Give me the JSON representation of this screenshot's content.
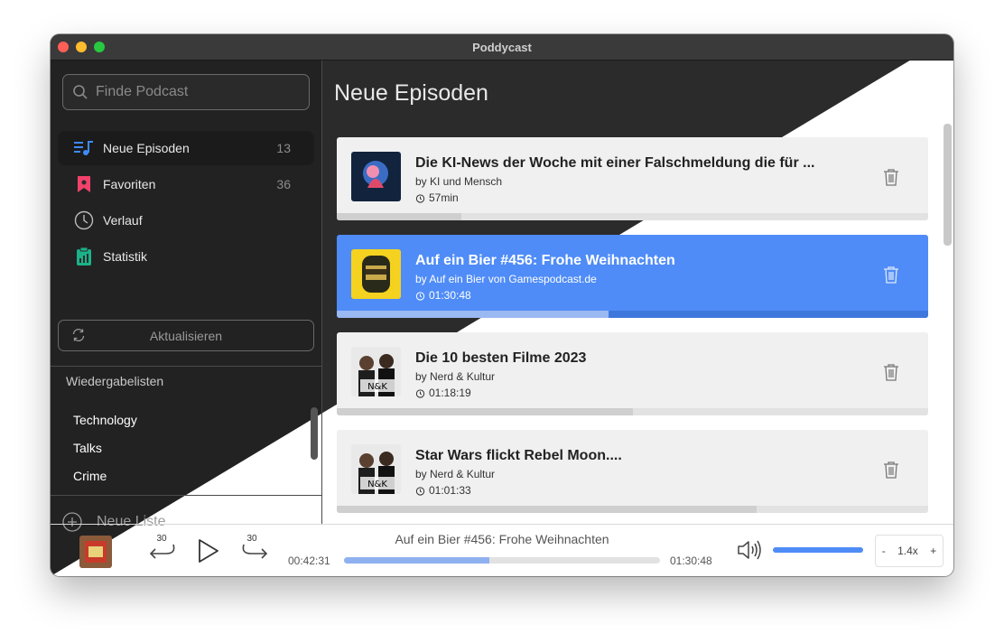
{
  "window": {
    "title": "Poddycast"
  },
  "search": {
    "placeholder": "Finde Podcast"
  },
  "nav": [
    {
      "label": "Neue Episoden",
      "count": "13",
      "icon": "music-list-icon",
      "color": "#3d8bfd",
      "active": true
    },
    {
      "label": "Favoriten",
      "count": "36",
      "icon": "bookmark-icon",
      "color": "#f0426b"
    },
    {
      "label": "Verlauf",
      "count": "",
      "icon": "clock-icon",
      "color": "#bbbbbb"
    },
    {
      "label": "Statistik",
      "count": "",
      "icon": "clipboard-chart-icon",
      "color": "#1bb28a"
    }
  ],
  "refresh": {
    "label": "Aktualisieren"
  },
  "playlists": {
    "heading": "Wiedergabelisten",
    "items": [
      "Technology",
      "Talks",
      "Crime"
    ],
    "new_label": "Neue Liste"
  },
  "main": {
    "title": "Neue Episoden"
  },
  "episodes": [
    {
      "title": "Die KI-News der Woche mit einer Falschmeldung die für ...",
      "author": "by KI und Mensch",
      "duration": "57min",
      "progress": 0.21,
      "selected": false
    },
    {
      "title": "Auf ein Bier #456: Frohe Weihnachten",
      "author": "by Auf ein Bier von Gamespodcast.de",
      "duration": "01:30:48",
      "progress": 0.46,
      "selected": true
    },
    {
      "title": "Die 10 besten Filme 2023",
      "author": "by Nerd & Kultur",
      "duration": "01:18:19",
      "progress": 0.5,
      "selected": false
    },
    {
      "title": "Star Wars flickt Rebel Moon....",
      "author": "by Nerd & Kultur",
      "duration": "01:01:33",
      "progress": 0.71,
      "selected": false
    }
  ],
  "player": {
    "title": "Auf ein Bier #456: Frohe Weihnachten",
    "current": "00:42:31",
    "total": "01:30:48",
    "skip_back": "30",
    "skip_forward": "30",
    "progress": 0.46,
    "volume": 1.0,
    "speed": {
      "minus": "-",
      "value": "1.4x",
      "plus": "+"
    }
  },
  "colors": {
    "accent": "#4f8cf7",
    "dark_bg": "#2b2b2b",
    "sidebar_dark": "#222222"
  }
}
